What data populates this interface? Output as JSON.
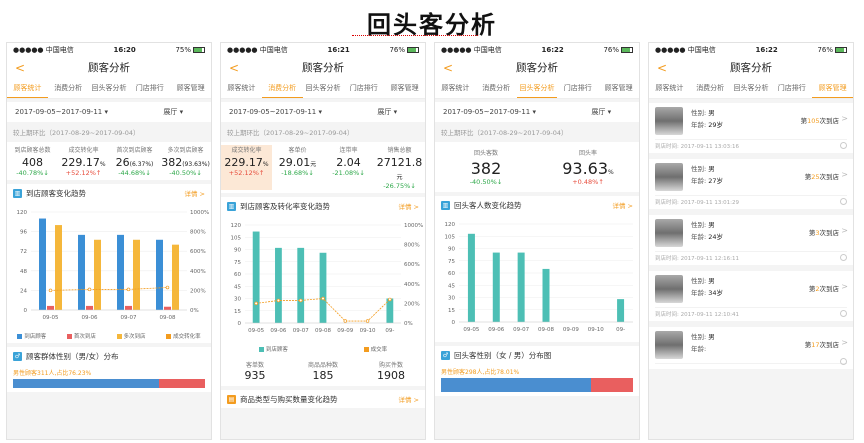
{
  "main_title": "回头客分析",
  "status": {
    "carrier": "●●●●● 中国电信",
    "times": [
      "16:20",
      "16:21",
      "16:22",
      "16:22"
    ],
    "batteries": [
      "75%",
      "76%",
      "76%",
      "76%"
    ]
  },
  "nav_title": "顾客分析",
  "back": "<",
  "tabs": [
    "顾客统计",
    "消费分析",
    "回头客分析",
    "门店排行",
    "顾客管理"
  ],
  "date_range": "2017-09-05~2017-09-11",
  "store": "展厅",
  "compare": "较上期环比（2017-08-29~2017-09-04）",
  "p1": {
    "metrics": [
      {
        "label": "到店顾客总数",
        "value": "408",
        "unit": "",
        "change": "-40.78%↓",
        "dir": "down"
      },
      {
        "label": "成交转化率",
        "value": "229.17",
        "unit": "%",
        "change": "+52.12%↑",
        "dir": "up"
      },
      {
        "label": "首次到店顾客",
        "value": "26",
        "unit": "(6.37%)",
        "change": "-44.68%↓",
        "dir": "down"
      },
      {
        "label": "多次到店顾客",
        "value": "382",
        "unit": "(93.63%)",
        "change": "-40.50%↓",
        "dir": "down"
      }
    ],
    "section1": "到店顾客变化趋势",
    "more": "详情 >",
    "legend": [
      "到店顾客",
      "首次到店",
      "多次到店",
      "成交转化率"
    ],
    "section2": "顾客群体性别（男/女）分布",
    "gender_text": "男性顾客311人,占比76.23%",
    "gender_pct": 76.23
  },
  "p2": {
    "metrics": [
      {
        "label": "成交转化率",
        "value": "229.17",
        "unit": "%",
        "change": "+52.12%↑",
        "dir": "up"
      },
      {
        "label": "客单价",
        "value": "29.01",
        "unit": "元",
        "change": "-18.68%↓",
        "dir": "down"
      },
      {
        "label": "连带率",
        "value": "2.04",
        "unit": "",
        "change": "-21.08%↓",
        "dir": "down"
      },
      {
        "label": "销售总额",
        "value": "27121.8",
        "unit": "元",
        "change": "-26.75%↓",
        "dir": "down"
      }
    ],
    "section1": "到店顾客及转化率变化趋势",
    "more": "详情 >",
    "legend": [
      "到店顾客",
      "成交率"
    ],
    "triple": [
      {
        "label": "客单数",
        "value": "935"
      },
      {
        "label": "商品品种数",
        "value": "185"
      },
      {
        "label": "购买件数",
        "value": "1908"
      }
    ],
    "section2": "商品类型与购买数量变化趋势"
  },
  "p3": {
    "metrics": [
      {
        "label": "回头客数",
        "value": "382",
        "change": "-40.50%↓",
        "dir": "down"
      },
      {
        "label": "回头率",
        "value": "93.63",
        "unit": "%",
        "change": "+0.48%↑",
        "dir": "up"
      }
    ],
    "section1": "回头客人数变化趋势",
    "more": "详情 >",
    "section2": "回头客性别（女 / 男）分布图",
    "gender_text": "男性顾客298人,占比78.01%",
    "gender_pct": 78.01
  },
  "p4": {
    "customers": [
      {
        "gender_label": "性别:",
        "gender": "男",
        "age_label": "年龄:",
        "age": "29岁",
        "visits_pre": "第",
        "visits": "105",
        "visits_post": "次到店",
        "time": "到店时间: 2017-09-11 13:03:16"
      },
      {
        "gender_label": "性别:",
        "gender": "男",
        "age_label": "年龄:",
        "age": "27岁",
        "visits_pre": "第",
        "visits": "25",
        "visits_post": "次到店",
        "time": "到店时间: 2017-09-11 13:01:29"
      },
      {
        "gender_label": "性别:",
        "gender": "男",
        "age_label": "年龄:",
        "age": "24岁",
        "visits_pre": "第",
        "visits": "3",
        "visits_post": "次到店",
        "time": "到店时间: 2017-09-11 12:16:11"
      },
      {
        "gender_label": "性别:",
        "gender": "男",
        "age_label": "年龄:",
        "age": "34岁",
        "visits_pre": "第",
        "visits": "2",
        "visits_post": "次到店",
        "time": "到店时间: 2017-09-11 12:10:41"
      },
      {
        "gender_label": "性别:",
        "gender": "男",
        "age_label": "年龄:",
        "age": "",
        "visits_pre": "第",
        "visits": "17",
        "visits_post": "次到店",
        "time": ""
      }
    ]
  },
  "chart_data": [
    {
      "type": "bar",
      "categories": [
        "09-05",
        "09-06",
        "09-07",
        "09-08"
      ],
      "yticks": [
        "0",
        "24",
        "48",
        "72",
        "96",
        "120"
      ],
      "y2ticks": [
        "0%",
        "200%",
        "400%",
        "600%",
        "800%",
        "1000%"
      ],
      "ylim": [
        0,
        120
      ],
      "series": [
        {
          "name": "到店顾客",
          "color": "#3b8fd6",
          "values": [
            112,
            92,
            92,
            86
          ]
        },
        {
          "name": "首次到店",
          "color": "#e95f5f",
          "values": [
            5,
            5,
            5,
            4
          ]
        },
        {
          "name": "多次到店",
          "color": "#f5b73b",
          "values": [
            104,
            86,
            86,
            80
          ]
        },
        {
          "name": "成交转化率",
          "color": "#f39c1f",
          "values": [
            200,
            210,
            210,
            230
          ],
          "axis": "y2"
        }
      ]
    },
    {
      "type": "bar",
      "categories": [
        "09-05",
        "09-06",
        "09-07",
        "09-08",
        "09-09",
        "09-10",
        "09-"
      ],
      "yticks": [
        "0",
        "15",
        "30",
        "45",
        "60",
        "75",
        "90",
        "105",
        "120"
      ],
      "y2ticks": [
        "0%",
        "200%",
        "400%",
        "600%",
        "800%",
        "1000%"
      ],
      "ylim": [
        0,
        120
      ],
      "series": [
        {
          "name": "到店顾客",
          "color": "#4dbfb5",
          "values": [
            112,
            92,
            92,
            86,
            0,
            0,
            30
          ]
        },
        {
          "name": "成交率",
          "color": "#f39c1f",
          "values": [
            200,
            230,
            230,
            250,
            20,
            20,
            240
          ],
          "axis": "y2"
        }
      ]
    },
    {
      "type": "bar",
      "categories": [
        "09-05",
        "09-06",
        "09-07",
        "09-08",
        "09-09",
        "09-10",
        "09-"
      ],
      "yticks": [
        "0",
        "15",
        "30",
        "45",
        "60",
        "75",
        "90",
        "105",
        "120"
      ],
      "ylim": [
        0,
        120
      ],
      "series": [
        {
          "name": "回头客数",
          "color": "#4dbfb5",
          "values": [
            108,
            85,
            85,
            65,
            0,
            0,
            28
          ]
        }
      ]
    }
  ]
}
